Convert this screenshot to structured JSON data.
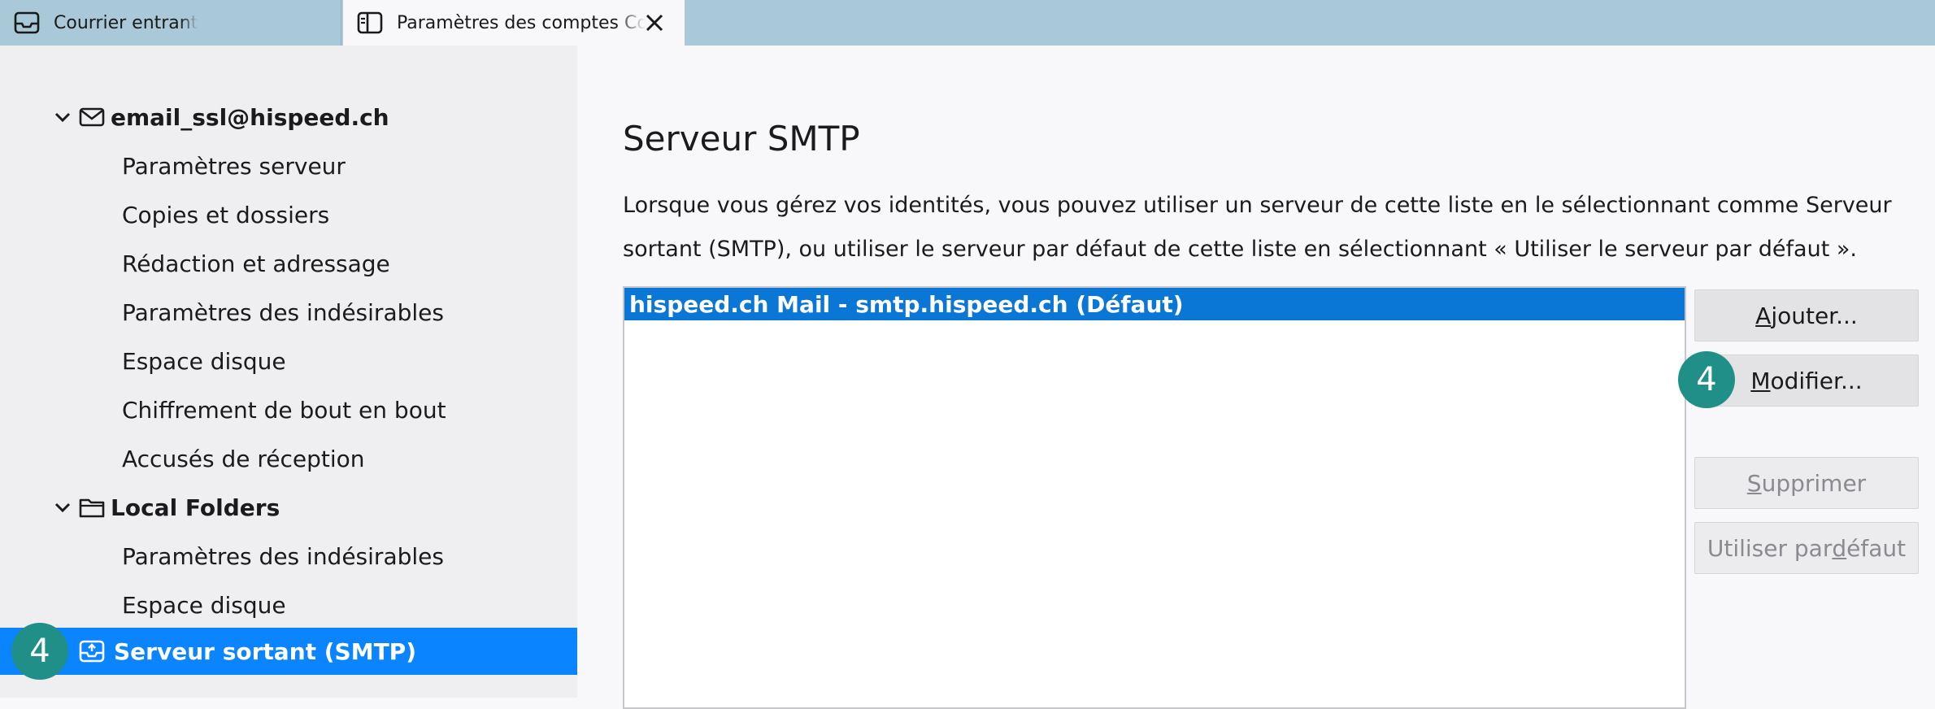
{
  "tabs": [
    {
      "label": "Courrier entrant",
      "icon": "inbox-icon"
    },
    {
      "label": "Paramètres des comptes Courrier",
      "icon": "account-settings-icon",
      "close": "close-icon"
    }
  ],
  "sidebar": {
    "account": {
      "label": "email_ssl@hispeed.ch",
      "icon": "envelope-icon"
    },
    "account_items": [
      "Paramètres serveur",
      "Copies et dossiers",
      "Rédaction et adressage",
      "Paramètres des indésirables",
      "Espace disque",
      "Chiffrement de bout en bout",
      "Accusés de réception"
    ],
    "local": {
      "label": "Local Folders",
      "icon": "folder-icon"
    },
    "local_items": [
      "Paramètres des indésirables",
      "Espace disque"
    ],
    "outgoing": {
      "label": "Serveur sortant (SMTP)",
      "icon": "outbox-icon"
    }
  },
  "main": {
    "title": "Serveur SMTP",
    "description": "Lorsque vous gérez vos identités, vous pouvez utiliser un serveur de cette liste en le sélectionnant comme Serveur sortant (SMTP), ou utiliser le serveur par défaut de cette liste en sélectionnant « Utiliser le serveur par défaut ».",
    "servers": [
      "hispeed.ch Mail - smtp.hispeed.ch (Défaut)"
    ],
    "buttons": {
      "add": {
        "pre": "",
        "key": "A",
        "post": "jouter..."
      },
      "edit": {
        "pre": "",
        "key": "M",
        "post": "odifier..."
      },
      "delete": {
        "pre": "",
        "key": "S",
        "post": "upprimer"
      },
      "default": {
        "pre": "Utiliser par ",
        "key": "d",
        "post": "éfaut"
      }
    }
  },
  "badges": {
    "sidebar": "4",
    "edit": "4"
  },
  "colors": {
    "selection": "#0a84ff",
    "badge": "#1f8f88",
    "tabbar": "#a9c8d8"
  }
}
